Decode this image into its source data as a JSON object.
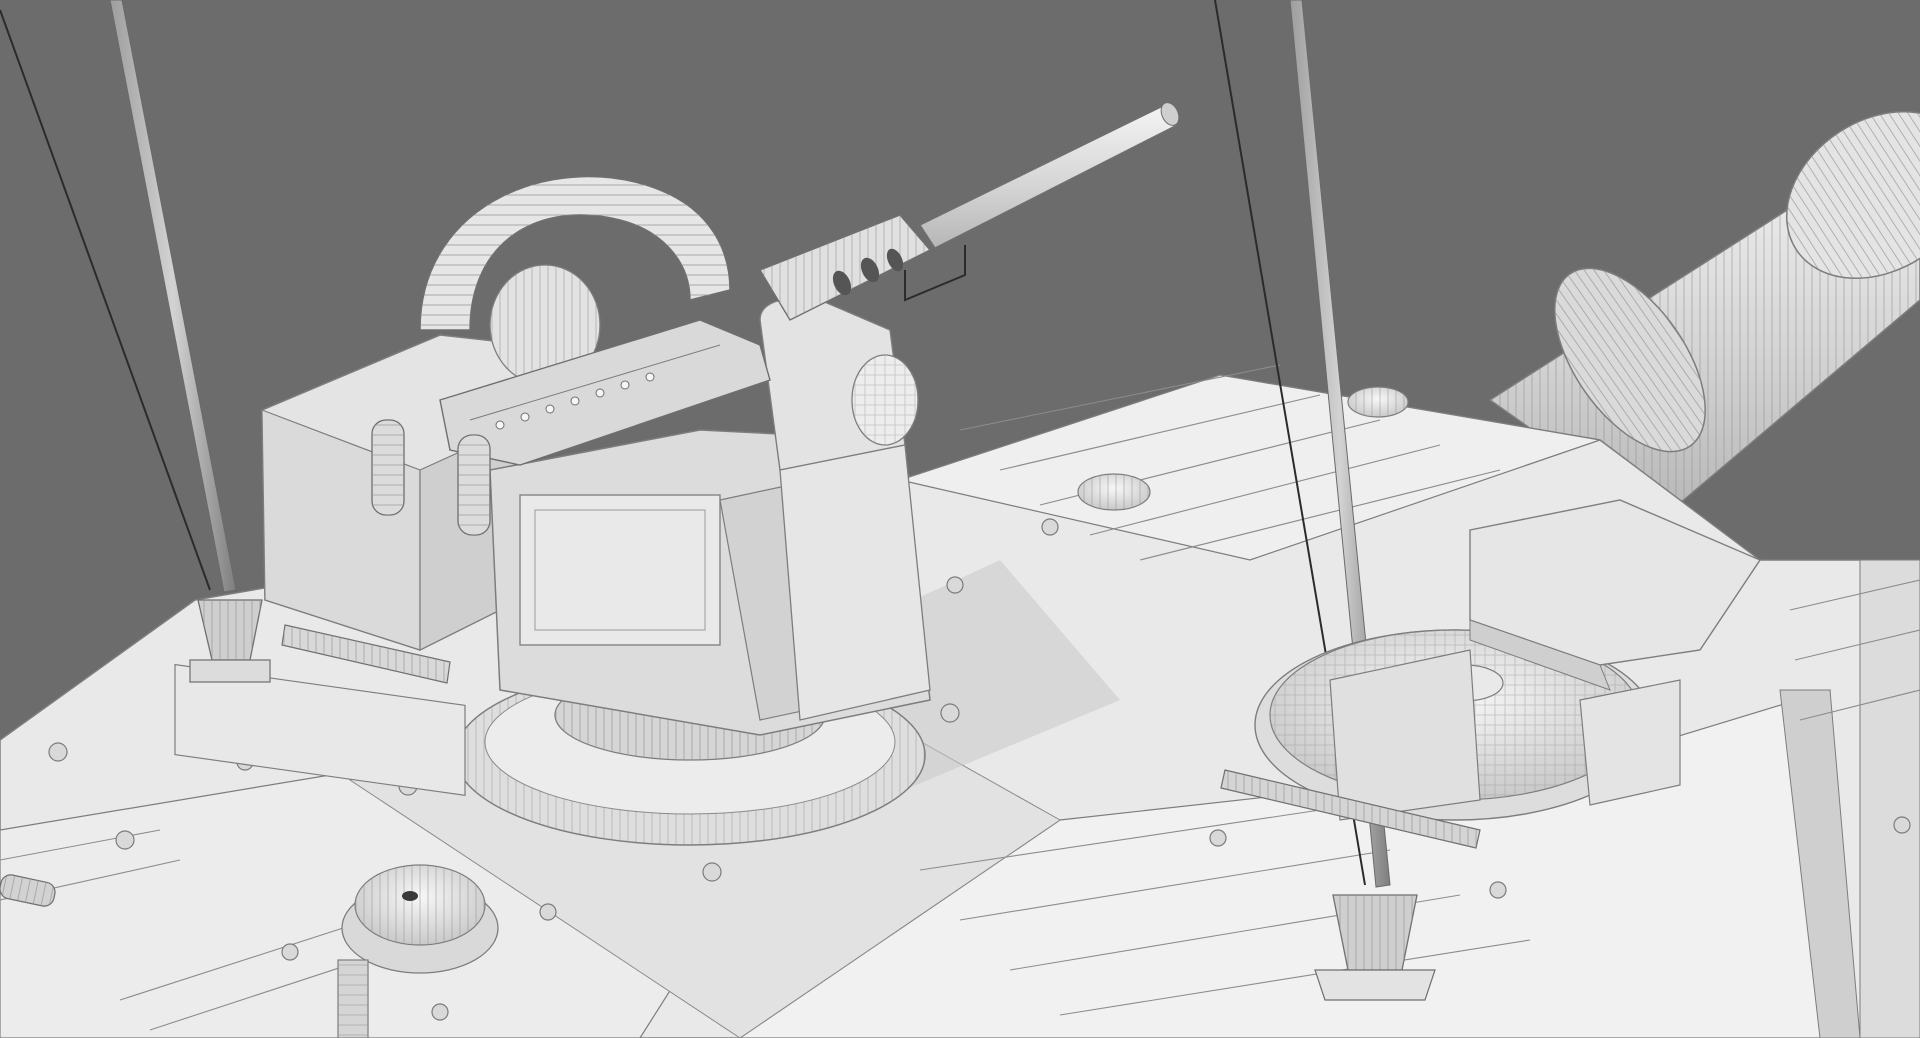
{
  "scene": {
    "subject": "",
    "colors": {
      "background": "#6c6c6c",
      "hull_top": "#e9e9e9",
      "hull_side": "#d9d9d9",
      "hull_shadow": "#c4c4c4",
      "model_light": "#f2f2f2",
      "model_mid": "#dedede",
      "model_dark": "#bdbdbd",
      "edge": "#7d7d7d",
      "wire": "#8e8e8e",
      "cable": "#2b2b2b"
    }
  }
}
